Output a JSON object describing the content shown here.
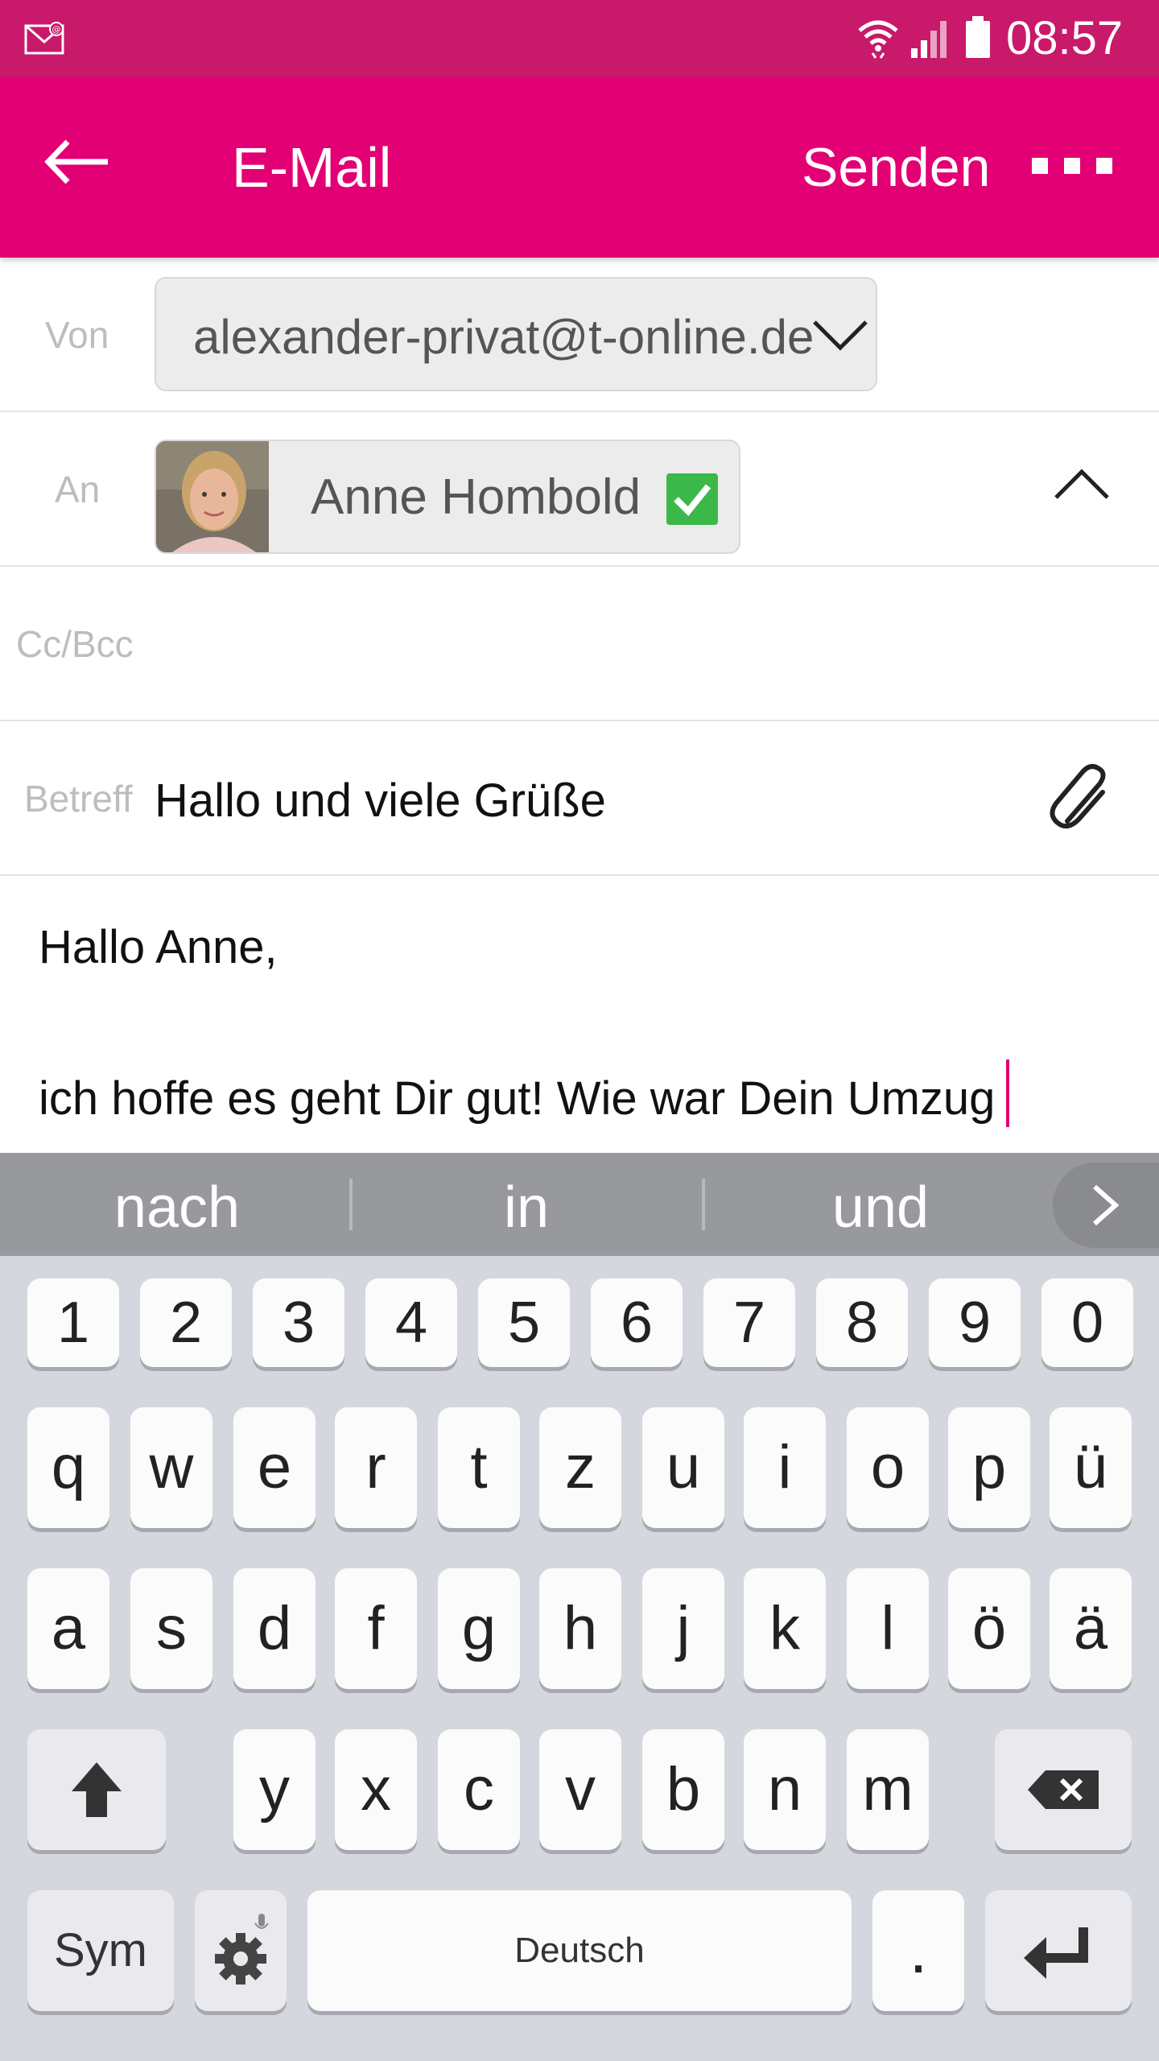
{
  "status_bar": {
    "time": "08:57",
    "notification_icon": "mail-icon",
    "icons": [
      "wifi-icon",
      "signal-icon",
      "battery-icon"
    ]
  },
  "app_bar": {
    "title": "E-Mail",
    "send_label": "Senden",
    "back_icon": "arrow-left-icon",
    "more_icon": "more-icon"
  },
  "form": {
    "from_label": "Von",
    "from_value": "alexander-privat@t-online.de",
    "to_label": "An",
    "to_recipient": "Anne Hombold",
    "cc_label": "Cc/Bcc",
    "subject_label": "Betreff",
    "subject_value": "Hallo und viele Grüße"
  },
  "body": {
    "line1": "Hallo Anne,",
    "line2": "ich hoffe es geht Dir gut! Wie war Dein Umzug"
  },
  "keyboard": {
    "suggestions": [
      "nach",
      "in",
      "und"
    ],
    "numbers": [
      "1",
      "2",
      "3",
      "4",
      "5",
      "6",
      "7",
      "8",
      "9",
      "0"
    ],
    "row1": [
      "q",
      "w",
      "e",
      "r",
      "t",
      "z",
      "u",
      "i",
      "o",
      "p",
      "ü"
    ],
    "row2": [
      "a",
      "s",
      "d",
      "f",
      "g",
      "h",
      "j",
      "k",
      "l",
      "ö",
      "ä"
    ],
    "row3": [
      "y",
      "x",
      "c",
      "v",
      "b",
      "n",
      "m"
    ],
    "sym_label": "Sym",
    "space_label": "Deutsch",
    "dot_label": "."
  },
  "colors": {
    "status_bar": "#c8196a",
    "app_bar": "#e20074",
    "check": "#3cb84a",
    "keyboard_bg": "#d5d7de"
  }
}
